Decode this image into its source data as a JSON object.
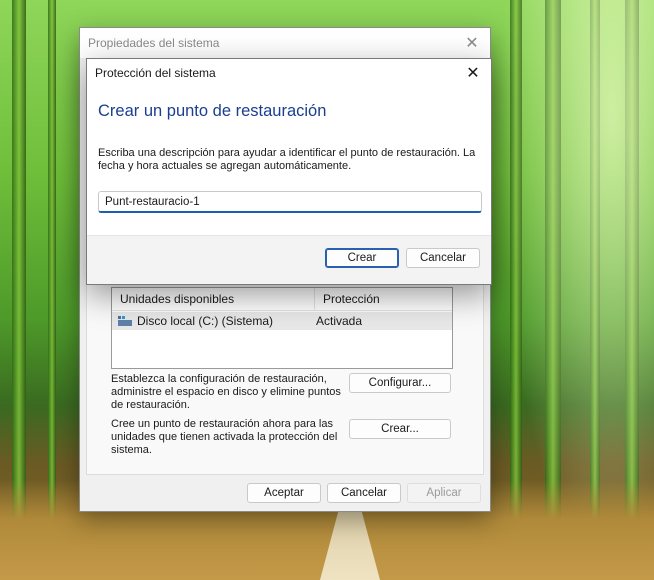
{
  "parent_dialog": {
    "title": "Propiedades del sistema",
    "close_glyph": "✕",
    "drives_table": {
      "columns": [
        "Unidades disponibles",
        "Protección"
      ],
      "rows": [
        {
          "drive": "Disco local (C:) (Sistema)",
          "protection": "Activada"
        }
      ]
    },
    "config_description": "Establezca la configuración de restauración, administre el espacio en disco y elimine puntos de restauración.",
    "config_button": "Configurar...",
    "create_description": "Cree un punto de restauración ahora para las unidades que tienen activada la protección del sistema.",
    "create_button": "Crear...",
    "ok_button": "Aceptar",
    "cancel_button": "Cancelar",
    "apply_button": "Aplicar"
  },
  "child_dialog": {
    "title": "Protección del sistema",
    "close_glyph": "✕",
    "heading": "Crear un punto de restauración",
    "instructions": "Escriba una descripción para ayudar a identificar el punto de restauración. La fecha y hora actuales se agregan automáticamente.",
    "input_value": "Punt-restauracio-1",
    "create_button": "Crear",
    "cancel_button": "Cancelar",
    "heading_color": "#1a3f8f",
    "accent_color": "#2b5fb0"
  }
}
